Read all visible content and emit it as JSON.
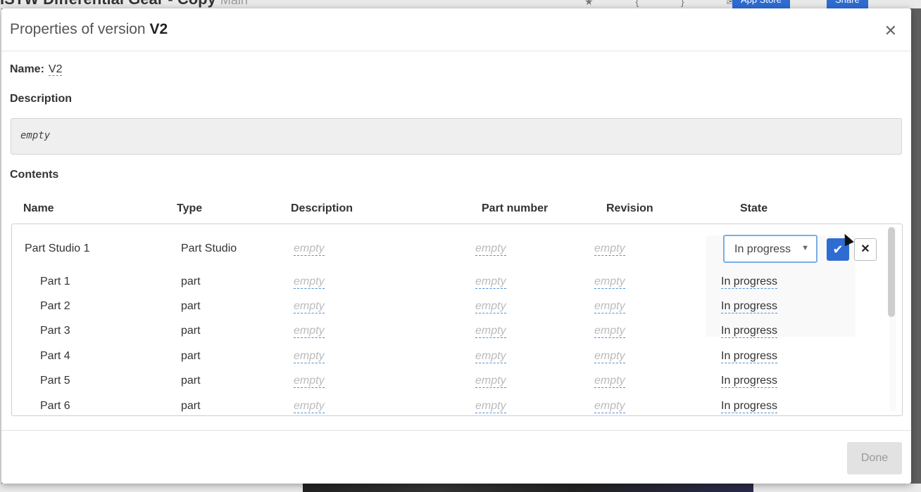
{
  "background": {
    "document_title": "ISTW Differential Gear - Copy",
    "branch": "Main",
    "app_store_label": "App Store",
    "share_label": "Share"
  },
  "dialog": {
    "title_prefix": "Properties of version",
    "title_version": "V2",
    "close_icon": "close-icon",
    "name_label": "Name:",
    "name_value": "V2",
    "description_label": "Description",
    "description_value": "empty",
    "contents_label": "Contents"
  },
  "table": {
    "columns": [
      "Name",
      "Type",
      "Description",
      "Part number",
      "Revision",
      "State"
    ],
    "rows": [
      {
        "name": "Part Studio 1",
        "type": "Part Studio",
        "description": "empty",
        "part_number": "empty",
        "revision": "empty",
        "state": "In progress"
      },
      {
        "name": "Part 1",
        "type": "part",
        "description": "empty",
        "part_number": "empty",
        "revision": "empty",
        "state": "In progress"
      },
      {
        "name": "Part 2",
        "type": "part",
        "description": "empty",
        "part_number": "empty",
        "revision": "empty",
        "state": "In progress"
      },
      {
        "name": "Part 3",
        "type": "part",
        "description": "empty",
        "part_number": "empty",
        "revision": "empty",
        "state": "In progress"
      },
      {
        "name": "Part 4",
        "type": "part",
        "description": "empty",
        "part_number": "empty",
        "revision": "empty",
        "state": "In progress"
      },
      {
        "name": "Part 5",
        "type": "part",
        "description": "empty",
        "part_number": "empty",
        "revision": "empty",
        "state": "In progress"
      },
      {
        "name": "Part 6",
        "type": "part",
        "description": "empty",
        "part_number": "empty",
        "revision": "empty",
        "state": "In progress"
      }
    ],
    "state_editor": {
      "selected": "In progress",
      "confirm_icon": "checkmark-icon",
      "cancel_icon": "close-icon"
    }
  },
  "footer": {
    "done_label": "Done"
  },
  "colors": {
    "accent": "#2e6cd1",
    "dashed_link": "#4a90d9"
  }
}
